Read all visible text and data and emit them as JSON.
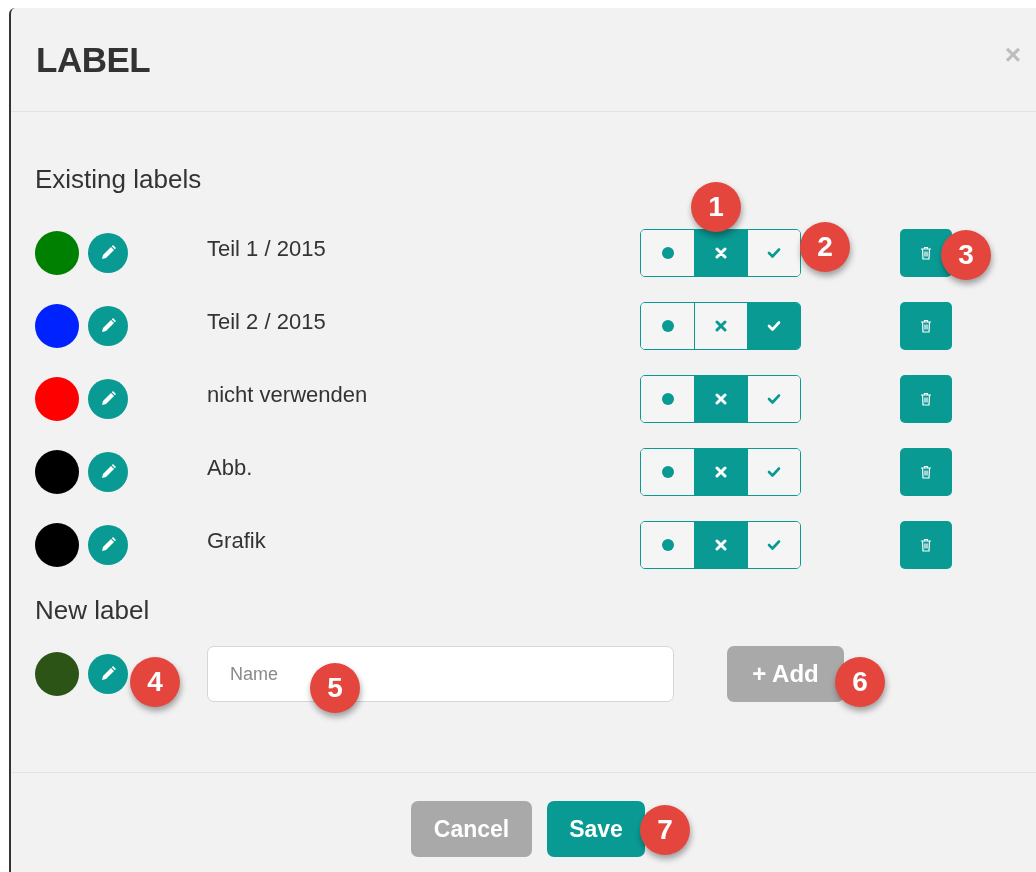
{
  "dialog": {
    "title": "LABEL",
    "close": "×"
  },
  "existing": {
    "heading": "Existing labels",
    "labels": [
      {
        "name": "Teil 1 / 2015",
        "color": "#008000",
        "toggle": [
          {
            "kind": "dot",
            "selected": false
          },
          {
            "kind": "cross",
            "selected": true
          },
          {
            "kind": "check",
            "selected": false
          }
        ]
      },
      {
        "name": "Teil 2 / 2015",
        "color": "#0022ff",
        "toggle": [
          {
            "kind": "dot",
            "selected": false
          },
          {
            "kind": "cross",
            "selected": false
          },
          {
            "kind": "check",
            "selected": true
          }
        ]
      },
      {
        "name": "nicht verwenden",
        "color": "#ff0000",
        "toggle": [
          {
            "kind": "dot",
            "selected": false
          },
          {
            "kind": "cross",
            "selected": true
          },
          {
            "kind": "check",
            "selected": false
          }
        ]
      },
      {
        "name": "Abb.",
        "color": "#000000",
        "toggle": [
          {
            "kind": "dot",
            "selected": false
          },
          {
            "kind": "cross",
            "selected": true
          },
          {
            "kind": "check",
            "selected": false
          }
        ]
      },
      {
        "name": "Grafik",
        "color": "#000000",
        "toggle": [
          {
            "kind": "dot",
            "selected": false
          },
          {
            "kind": "cross",
            "selected": true
          },
          {
            "kind": "check",
            "selected": false
          }
        ]
      }
    ]
  },
  "new_label": {
    "heading": "New label",
    "color": "#2b5416",
    "placeholder": "Name",
    "add_button": "+ Add"
  },
  "footer": {
    "buttons": [
      {
        "label": "Cancel",
        "kind": "secondary"
      },
      {
        "label": "Save",
        "kind": "primary"
      }
    ]
  },
  "callouts": [
    "1",
    "2",
    "3",
    "4",
    "5",
    "6",
    "7"
  ]
}
